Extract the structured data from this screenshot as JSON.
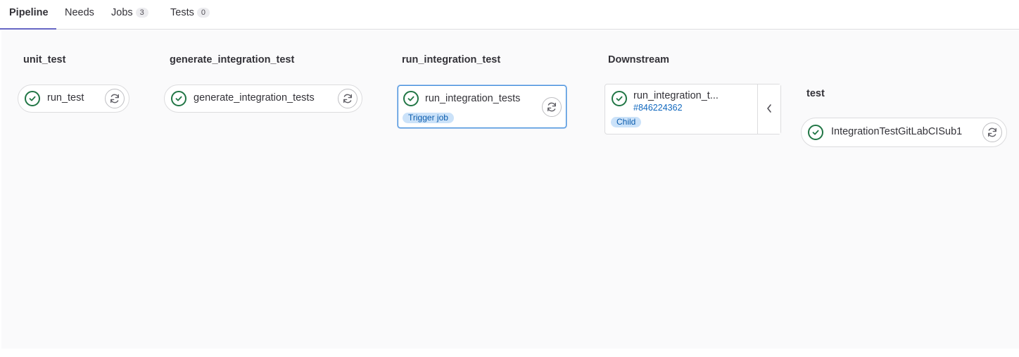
{
  "tabs": [
    {
      "label": "Pipeline"
    },
    {
      "label": "Needs"
    },
    {
      "label": "Jobs",
      "count": "3"
    },
    {
      "label": "Tests",
      "count": "0"
    }
  ],
  "stages": [
    {
      "title": "unit_test",
      "jobs": [
        {
          "name": "run_test",
          "status": "success"
        }
      ]
    },
    {
      "title": "generate_integration_test",
      "jobs": [
        {
          "name": "generate_integration_tests",
          "status": "success"
        }
      ]
    },
    {
      "title": "run_integration_test",
      "jobs": [
        {
          "name": "run_integration_tests",
          "badge": "Trigger job",
          "status": "success"
        }
      ]
    }
  ],
  "downstream": {
    "title": "Downstream",
    "name": "run_integration_t...",
    "pipeline_id": "#846224362",
    "badge": "Child",
    "status": "success"
  },
  "child_stage": {
    "title": "test",
    "jobs": [
      {
        "name": "IntegrationTestGitLabCISub1",
        "status": "success"
      }
    ]
  },
  "colors": {
    "success": "#217645",
    "accent": "#6666c4",
    "link": "#1068bf"
  },
  "icons": {
    "status": "check-circle-icon",
    "retry": "retry-icon",
    "expand": "chevron-left-icon"
  }
}
